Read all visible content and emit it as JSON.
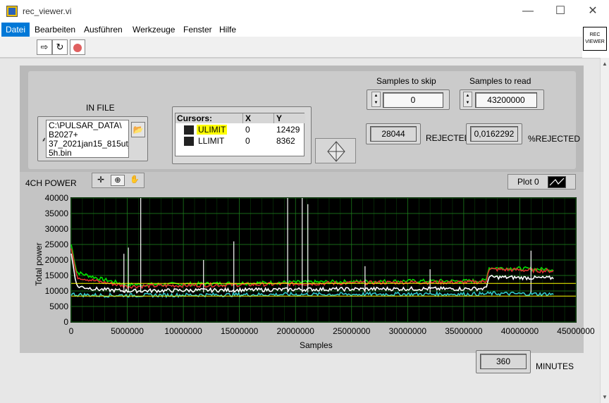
{
  "window": {
    "title": "rec_viewer.vi",
    "minimize": "—",
    "maximize": "☐",
    "close": "✕"
  },
  "menu": [
    "Datei",
    "Bearbeiten",
    "Ausführen",
    "Werkzeuge",
    "Fenster",
    "Hilfe"
  ],
  "toolbar": {
    "run_icon": "run-arrow-icon",
    "run_continuous_icon": "run-continuously-icon",
    "abort_icon": "abort-stop-icon",
    "vi_icon_line1": "REC",
    "vi_icon_line2": "VIEWER"
  },
  "controls": {
    "infile_label": "IN FILE",
    "infile_value": "C:\\PULSAR_DATA\\B2027+37_2021jan15_815ut_",
    "infile_lines": [
      "C:\\PULSAR_DATA\\",
      "B2027+",
      "37_2021jan15_815ut_",
      "5h.bin"
    ],
    "samples_to_skip_label": "Samples to skip",
    "samples_to_skip": "0",
    "samples_to_read_label": "Samples to read",
    "samples_to_read": "43200000",
    "rejected_value": "28044",
    "rejected_label": "REJECTED",
    "pct_rejected_value": "0,0162292",
    "pct_rejected_label": "%REJECTED",
    "minutes_value": "360",
    "minutes_label": "MINUTES"
  },
  "cursors": {
    "headers": [
      "Cursors:",
      "X",
      "Y"
    ],
    "rows": [
      {
        "name": "ULIMIT",
        "x": "0",
        "y": "12429"
      },
      {
        "name": "LLIMIT",
        "x": "0",
        "y": "8362"
      }
    ],
    "highlight_color": "#ffff00"
  },
  "graph": {
    "title": "4CH POWER",
    "legend_label": "Plot 0",
    "palette_icons": [
      "crosshair-icon",
      "zoom-icon",
      "hand-pan-icon"
    ]
  },
  "chart_data": {
    "type": "line",
    "xlabel": "Samples",
    "ylabel": "Total power",
    "xlim": [
      0,
      45000000
    ],
    "ylim": [
      0,
      40000
    ],
    "x_ticks": [
      0,
      5000000,
      10000000,
      15000000,
      20000000,
      25000000,
      30000000,
      35000000,
      40000000,
      45000000
    ],
    "y_ticks": [
      0,
      5000,
      10000,
      15000,
      20000,
      25000,
      30000,
      35000,
      40000
    ],
    "x_tick_labels": [
      "0",
      "5000000",
      "10000000",
      "15000000",
      "20000000",
      "25000000",
      "30000000",
      "35000000",
      "40000000",
      "45000000"
    ],
    "y_tick_labels": [
      "0",
      "5000",
      "10000",
      "15000",
      "20000",
      "25000",
      "30000",
      "35000",
      "40000"
    ],
    "grid": true,
    "background": "#000000",
    "grid_color": "#1f8a1f",
    "limit_lines": [
      {
        "name": "ULIMIT",
        "y": 12429,
        "color": "#ffff00"
      },
      {
        "name": "LLIMIT",
        "y": 8362,
        "color": "#ffff00"
      }
    ],
    "series": [
      {
        "color": "#00e000",
        "x": [
          0,
          500000,
          2500000,
          5000000,
          10000000,
          15000000,
          20000000,
          25000000,
          30000000,
          35000000,
          37000000,
          37200000,
          40000000,
          42000000,
          43000000
        ],
        "y": [
          25000,
          16000,
          14000,
          12000,
          12200,
          12500,
          12800,
          13000,
          13200,
          13200,
          13400,
          17500,
          17200,
          17000,
          17000
        ]
      },
      {
        "color": "#e03030",
        "x": [
          0,
          500000,
          2500000,
          5000000,
          10000000,
          15000000,
          20000000,
          25000000,
          30000000,
          35000000,
          37000000,
          37200000,
          40000000,
          42000000,
          43000000
        ],
        "y": [
          24000,
          14500,
          13000,
          11500,
          11800,
          12000,
          12300,
          12600,
          12800,
          12800,
          13000,
          17000,
          16800,
          16500,
          16500
        ]
      },
      {
        "color": "#ffffff",
        "x": [
          0,
          500000,
          2500000,
          5000000,
          10000000,
          15000000,
          20000000,
          25000000,
          30000000,
          35000000,
          37000000,
          37200000,
          40000000,
          42000000,
          43000000
        ],
        "y": [
          22000,
          11500,
          10500,
          10000,
          10200,
          10300,
          10500,
          10600,
          10700,
          10700,
          10800,
          14500,
          14300,
          14200,
          14200
        ]
      },
      {
        "color": "#30c8c8",
        "x": [
          0,
          500000,
          2500000,
          5000000,
          10000000,
          15000000,
          20000000,
          25000000,
          30000000,
          35000000,
          37000000,
          37200000,
          40000000,
          42000000,
          43000000
        ],
        "y": [
          9000,
          8800,
          8600,
          8600,
          8700,
          8800,
          8900,
          8900,
          9000,
          9000,
          9000,
          9200,
          9100,
          9000,
          9000
        ]
      }
    ],
    "spikes": [
      {
        "x": 6200000,
        "y": 40000
      },
      {
        "x": 19300000,
        "y": 40000
      },
      {
        "x": 20600000,
        "y": 40000
      },
      {
        "x": 21100000,
        "y": 38000
      },
      {
        "x": 14500000,
        "y": 26000
      },
      {
        "x": 5100000,
        "y": 24000
      },
      {
        "x": 4700000,
        "y": 22000
      },
      {
        "x": 11800000,
        "y": 20000
      },
      {
        "x": 26200000,
        "y": 18000
      },
      {
        "x": 32000000,
        "y": 17000
      },
      {
        "x": 41000000,
        "y": 23000
      }
    ]
  }
}
